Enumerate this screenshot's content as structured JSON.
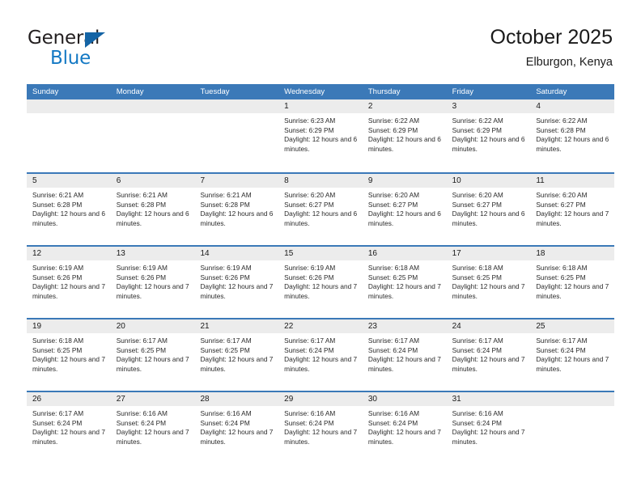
{
  "brand": {
    "name_primary": "General",
    "name_secondary": "Blue",
    "flag_icon": "flag-triangle-icon",
    "accent_color": "#1479c4"
  },
  "header": {
    "title": "October 2025",
    "subtitle": "Elburgon, Kenya"
  },
  "theme": {
    "header_row_color": "#3b79b8",
    "daynum_background": "#ececec",
    "text_color": "#1a1a1a"
  },
  "calendar": {
    "day_headers": [
      "Sunday",
      "Monday",
      "Tuesday",
      "Wednesday",
      "Thursday",
      "Friday",
      "Saturday"
    ],
    "weeks": [
      [
        {
          "day": "",
          "blank": true,
          "sunrise": "",
          "sunset": "",
          "daylight": ""
        },
        {
          "day": "",
          "blank": true,
          "sunrise": "",
          "sunset": "",
          "daylight": ""
        },
        {
          "day": "",
          "blank": true,
          "sunrise": "",
          "sunset": "",
          "daylight": ""
        },
        {
          "day": "1",
          "sunrise": "Sunrise: 6:23 AM",
          "sunset": "Sunset: 6:29 PM",
          "daylight": "Daylight: 12 hours and 6 minutes."
        },
        {
          "day": "2",
          "sunrise": "Sunrise: 6:22 AM",
          "sunset": "Sunset: 6:29 PM",
          "daylight": "Daylight: 12 hours and 6 minutes."
        },
        {
          "day": "3",
          "sunrise": "Sunrise: 6:22 AM",
          "sunset": "Sunset: 6:29 PM",
          "daylight": "Daylight: 12 hours and 6 minutes."
        },
        {
          "day": "4",
          "sunrise": "Sunrise: 6:22 AM",
          "sunset": "Sunset: 6:28 PM",
          "daylight": "Daylight: 12 hours and 6 minutes."
        }
      ],
      [
        {
          "day": "5",
          "sunrise": "Sunrise: 6:21 AM",
          "sunset": "Sunset: 6:28 PM",
          "daylight": "Daylight: 12 hours and 6 minutes."
        },
        {
          "day": "6",
          "sunrise": "Sunrise: 6:21 AM",
          "sunset": "Sunset: 6:28 PM",
          "daylight": "Daylight: 12 hours and 6 minutes."
        },
        {
          "day": "7",
          "sunrise": "Sunrise: 6:21 AM",
          "sunset": "Sunset: 6:28 PM",
          "daylight": "Daylight: 12 hours and 6 minutes."
        },
        {
          "day": "8",
          "sunrise": "Sunrise: 6:20 AM",
          "sunset": "Sunset: 6:27 PM",
          "daylight": "Daylight: 12 hours and 6 minutes."
        },
        {
          "day": "9",
          "sunrise": "Sunrise: 6:20 AM",
          "sunset": "Sunset: 6:27 PM",
          "daylight": "Daylight: 12 hours and 6 minutes."
        },
        {
          "day": "10",
          "sunrise": "Sunrise: 6:20 AM",
          "sunset": "Sunset: 6:27 PM",
          "daylight": "Daylight: 12 hours and 6 minutes."
        },
        {
          "day": "11",
          "sunrise": "Sunrise: 6:20 AM",
          "sunset": "Sunset: 6:27 PM",
          "daylight": "Daylight: 12 hours and 7 minutes."
        }
      ],
      [
        {
          "day": "12",
          "sunrise": "Sunrise: 6:19 AM",
          "sunset": "Sunset: 6:26 PM",
          "daylight": "Daylight: 12 hours and 7 minutes."
        },
        {
          "day": "13",
          "sunrise": "Sunrise: 6:19 AM",
          "sunset": "Sunset: 6:26 PM",
          "daylight": "Daylight: 12 hours and 7 minutes."
        },
        {
          "day": "14",
          "sunrise": "Sunrise: 6:19 AM",
          "sunset": "Sunset: 6:26 PM",
          "daylight": "Daylight: 12 hours and 7 minutes."
        },
        {
          "day": "15",
          "sunrise": "Sunrise: 6:19 AM",
          "sunset": "Sunset: 6:26 PM",
          "daylight": "Daylight: 12 hours and 7 minutes."
        },
        {
          "day": "16",
          "sunrise": "Sunrise: 6:18 AM",
          "sunset": "Sunset: 6:25 PM",
          "daylight": "Daylight: 12 hours and 7 minutes."
        },
        {
          "day": "17",
          "sunrise": "Sunrise: 6:18 AM",
          "sunset": "Sunset: 6:25 PM",
          "daylight": "Daylight: 12 hours and 7 minutes."
        },
        {
          "day": "18",
          "sunrise": "Sunrise: 6:18 AM",
          "sunset": "Sunset: 6:25 PM",
          "daylight": "Daylight: 12 hours and 7 minutes."
        }
      ],
      [
        {
          "day": "19",
          "sunrise": "Sunrise: 6:18 AM",
          "sunset": "Sunset: 6:25 PM",
          "daylight": "Daylight: 12 hours and 7 minutes."
        },
        {
          "day": "20",
          "sunrise": "Sunrise: 6:17 AM",
          "sunset": "Sunset: 6:25 PM",
          "daylight": "Daylight: 12 hours and 7 minutes."
        },
        {
          "day": "21",
          "sunrise": "Sunrise: 6:17 AM",
          "sunset": "Sunset: 6:25 PM",
          "daylight": "Daylight: 12 hours and 7 minutes."
        },
        {
          "day": "22",
          "sunrise": "Sunrise: 6:17 AM",
          "sunset": "Sunset: 6:24 PM",
          "daylight": "Daylight: 12 hours and 7 minutes."
        },
        {
          "day": "23",
          "sunrise": "Sunrise: 6:17 AM",
          "sunset": "Sunset: 6:24 PM",
          "daylight": "Daylight: 12 hours and 7 minutes."
        },
        {
          "day": "24",
          "sunrise": "Sunrise: 6:17 AM",
          "sunset": "Sunset: 6:24 PM",
          "daylight": "Daylight: 12 hours and 7 minutes."
        },
        {
          "day": "25",
          "sunrise": "Sunrise: 6:17 AM",
          "sunset": "Sunset: 6:24 PM",
          "daylight": "Daylight: 12 hours and 7 minutes."
        }
      ],
      [
        {
          "day": "26",
          "sunrise": "Sunrise: 6:17 AM",
          "sunset": "Sunset: 6:24 PM",
          "daylight": "Daylight: 12 hours and 7 minutes."
        },
        {
          "day": "27",
          "sunrise": "Sunrise: 6:16 AM",
          "sunset": "Sunset: 6:24 PM",
          "daylight": "Daylight: 12 hours and 7 minutes."
        },
        {
          "day": "28",
          "sunrise": "Sunrise: 6:16 AM",
          "sunset": "Sunset: 6:24 PM",
          "daylight": "Daylight: 12 hours and 7 minutes."
        },
        {
          "day": "29",
          "sunrise": "Sunrise: 6:16 AM",
          "sunset": "Sunset: 6:24 PM",
          "daylight": "Daylight: 12 hours and 7 minutes."
        },
        {
          "day": "30",
          "sunrise": "Sunrise: 6:16 AM",
          "sunset": "Sunset: 6:24 PM",
          "daylight": "Daylight: 12 hours and 7 minutes."
        },
        {
          "day": "31",
          "sunrise": "Sunrise: 6:16 AM",
          "sunset": "Sunset: 6:24 PM",
          "daylight": "Daylight: 12 hours and 7 minutes."
        },
        {
          "day": "",
          "blank": true,
          "sunrise": "",
          "sunset": "",
          "daylight": ""
        }
      ]
    ]
  }
}
